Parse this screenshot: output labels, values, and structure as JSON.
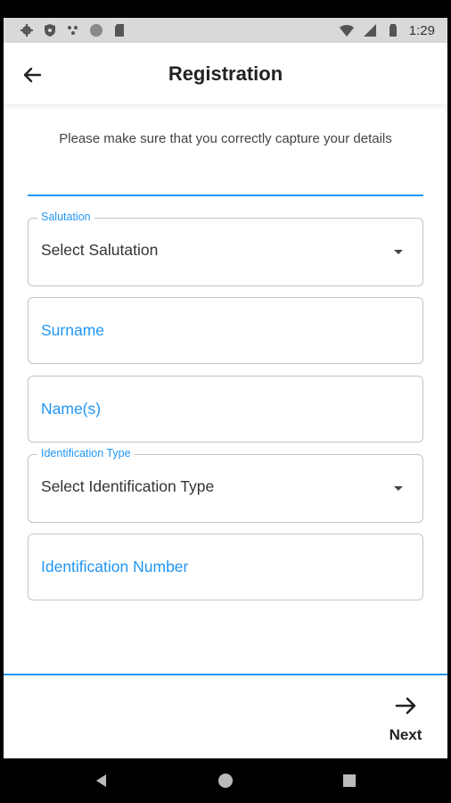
{
  "status_bar": {
    "time": "1:29",
    "icons_left": [
      "gear-icon",
      "shield-icon",
      "dots-icon",
      "circle-icon",
      "sd-card-icon"
    ],
    "icons_right": [
      "wifi-icon",
      "cell-signal-icon",
      "battery-icon"
    ]
  },
  "app_bar": {
    "title": "Registration",
    "back_icon": "arrow-left-icon"
  },
  "intro_text": "Please make sure that you correctly capture your details",
  "form": {
    "salutation": {
      "label": "Salutation",
      "value": "Select Salutation"
    },
    "surname": {
      "placeholder": "Surname"
    },
    "names": {
      "placeholder": "Name(s)"
    },
    "identification_type": {
      "label": "Identification Type",
      "value": "Select Identification Type"
    },
    "identification_number": {
      "placeholder": "Identification Number"
    }
  },
  "footer": {
    "next_label": "Next",
    "next_icon": "arrow-right-icon"
  },
  "nav_bar": {
    "icons": [
      "back-triangle-icon",
      "home-circle-icon",
      "recents-square-icon"
    ]
  },
  "colors": {
    "accent": "#2196f3",
    "status_bar": "#d9d9d9",
    "border": "#c4c4c4"
  }
}
